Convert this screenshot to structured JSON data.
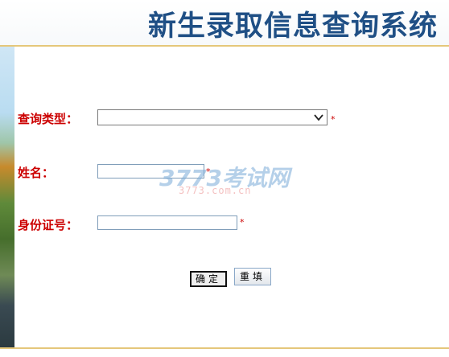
{
  "header": {
    "title": "新生录取信息查询系统"
  },
  "form": {
    "query_type": {
      "label": "查询类型：",
      "selected": "",
      "required_mark": "*"
    },
    "name": {
      "label": "姓名：",
      "value": "",
      "required_mark": "*"
    },
    "id_number": {
      "label": "身份证号：",
      "value": "",
      "required_mark": "*"
    },
    "buttons": {
      "confirm_label": "确定",
      "reset_label": "重填"
    }
  },
  "watermark": {
    "main": "3773考试网",
    "sub": "3773.com.cn"
  },
  "colors": {
    "title": "#1f4f85",
    "label": "#cc0000",
    "accent_line": "#e5c77a"
  }
}
